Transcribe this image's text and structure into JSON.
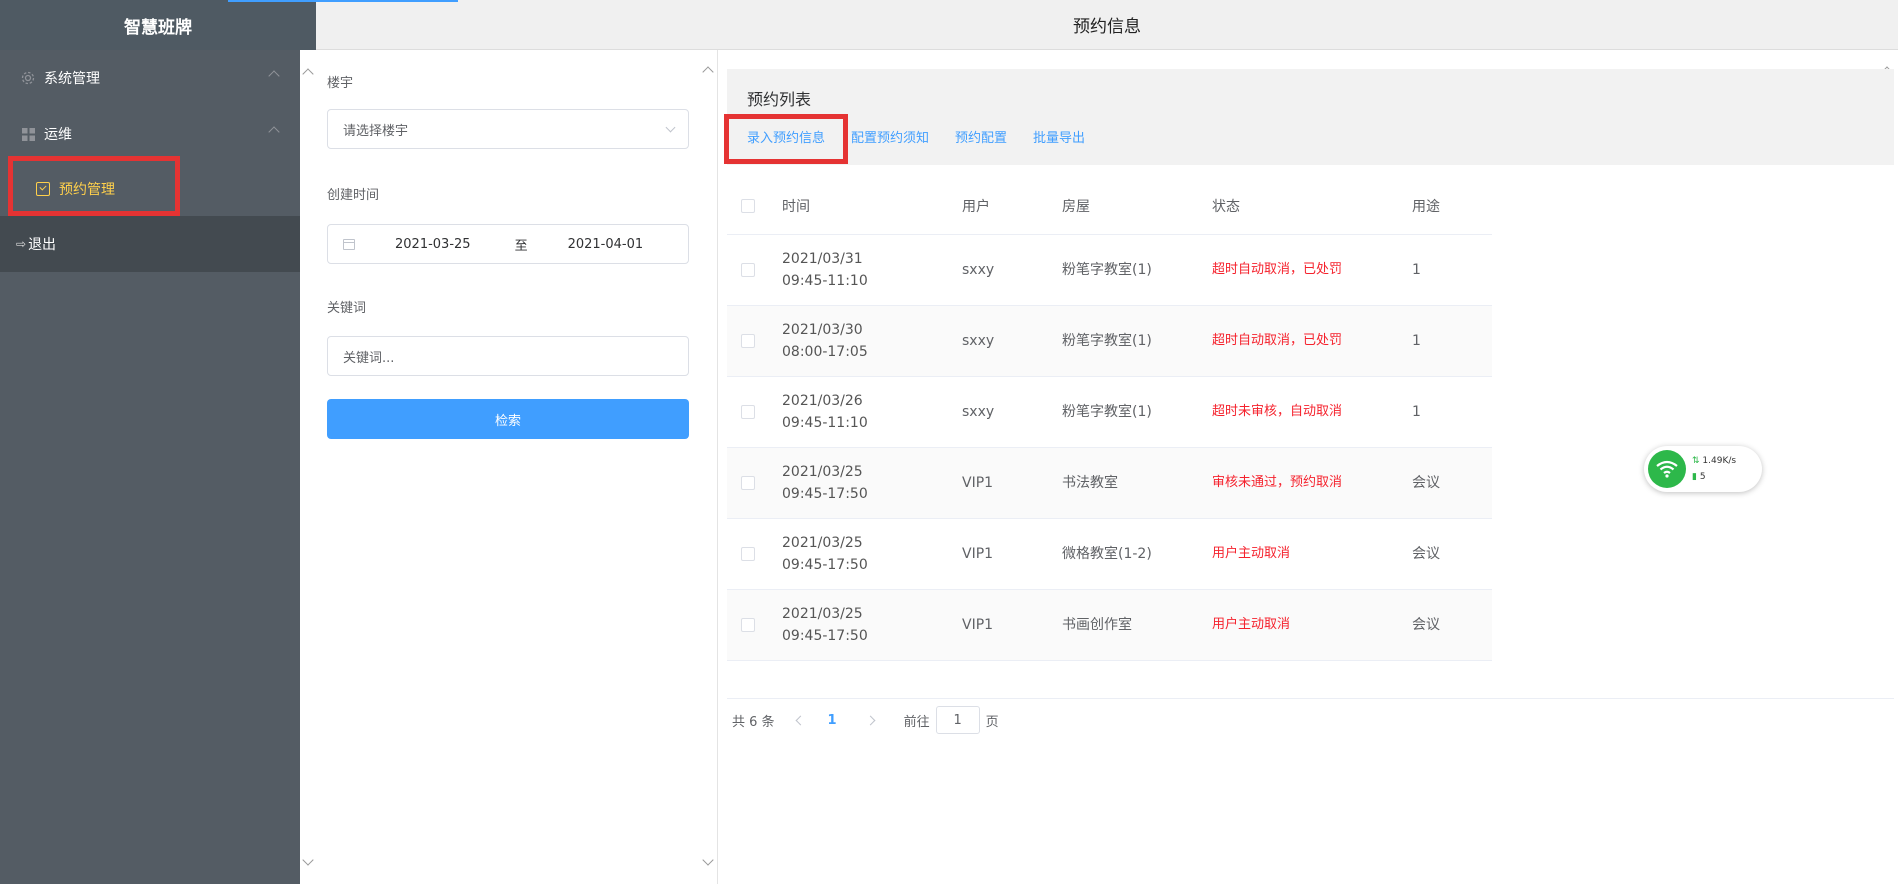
{
  "app": {
    "brand": "智慧班牌",
    "header_title": "预约信息"
  },
  "sidebar": {
    "items": [
      {
        "label": "系统管理",
        "icon": "gear-icon"
      },
      {
        "label": "运维",
        "icon": "grid-icon"
      }
    ],
    "active_sub": {
      "label": "预约管理",
      "icon": "calendar-check-icon"
    },
    "logout": {
      "label": "退出",
      "icon": "logout-icon"
    }
  },
  "filter": {
    "building_label": "楼宇",
    "building_placeholder": "请选择楼宇",
    "created_label": "创建时间",
    "date_start": "2021-03-25",
    "date_sep": "至",
    "date_end": "2021-04-01",
    "keyword_label": "关键词",
    "keyword_placeholder": "关键词...",
    "search_button": "检索"
  },
  "main": {
    "card_title": "预约列表",
    "actions": [
      "录入预约信息",
      "配置预约须知",
      "预约配置",
      "批量导出"
    ],
    "columns": [
      "时间",
      "用户",
      "房屋",
      "状态",
      "用途"
    ],
    "rows": [
      {
        "date": "2021/03/31",
        "time": "09:45-11:10",
        "user": "sxxy",
        "room": "粉笔字教室(1)",
        "status": "超时自动取消，已处罚",
        "use": "1"
      },
      {
        "date": "2021/03/30",
        "time": "08:00-17:05",
        "user": "sxxy",
        "room": "粉笔字教室(1)",
        "status": "超时自动取消，已处罚",
        "use": "1"
      },
      {
        "date": "2021/03/26",
        "time": "09:45-11:10",
        "user": "sxxy",
        "room": "粉笔字教室(1)",
        "status": "超时未审核，自动取消",
        "use": "1"
      },
      {
        "date": "2021/03/25",
        "time": "09:45-17:50",
        "user": "VIP1",
        "room": "书法教室",
        "status": "审核未通过，预约取消",
        "use": "会议"
      },
      {
        "date": "2021/03/25",
        "time": "09:45-17:50",
        "user": "VIP1",
        "room": "微格教室(1-2)",
        "status": "用户主动取消",
        "use": "会议"
      },
      {
        "date": "2021/03/25",
        "time": "09:45-17:50",
        "user": "VIP1",
        "room": "书画创作室",
        "status": "用户主动取消",
        "use": "会议"
      }
    ],
    "pager": {
      "total": "共 6 条",
      "current": "1",
      "goto_prefix": "前往",
      "goto_value": "1",
      "goto_suffix": "页"
    }
  },
  "net_widget": {
    "speed": "1.49K/s",
    "count": "5"
  },
  "colors": {
    "accent": "#409eff",
    "sidebar": "#545c64",
    "active": "#ffd04b",
    "status_red": "#f5222d",
    "highlight": "#e53333"
  }
}
